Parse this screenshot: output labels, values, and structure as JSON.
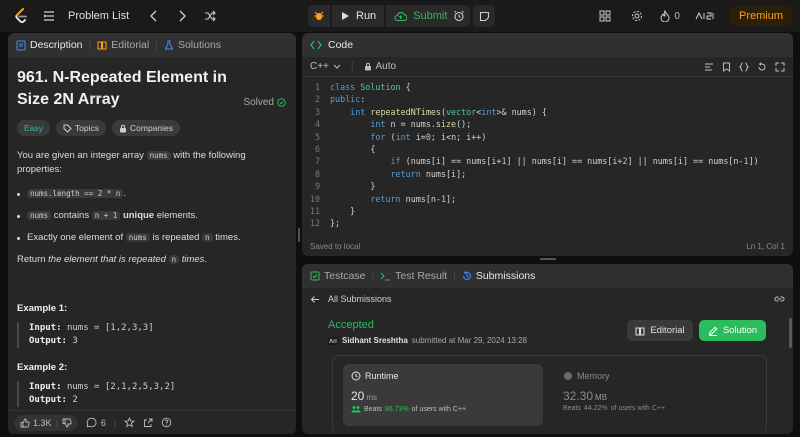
{
  "topbar": {
    "problem_list": "Problem List",
    "run": "Run",
    "submit": "Submit",
    "streak": "0",
    "premium": "Premium"
  },
  "left_panel": {
    "tabs": [
      "Description",
      "Editorial",
      "Solutions"
    ],
    "title": "961. N-Repeated Element in Size 2N Array",
    "solved": "Solved",
    "chips": [
      "Easy",
      "Topics",
      "Companies"
    ],
    "intro_pre": "You are given an integer array ",
    "intro_code": "nums",
    "intro_post": " with the following properties:",
    "prop1_code": "nums.length == 2 * n",
    "prop1_post": ".",
    "prop2_code1": "nums",
    "prop2_mid": " contains ",
    "prop2_code2": "n + 1",
    "prop2_bold": "unique",
    "prop2_post": " elements.",
    "prop3_pre": "Exactly one element of ",
    "prop3_code": "nums",
    "prop3_mid": " is repeated ",
    "prop3_code2": "n",
    "prop3_post": " times.",
    "ret_pre": "Return ",
    "ret_em": "the element that is repeated ",
    "ret_code": "n",
    "ret_em2": " times",
    "ret_post": ".",
    "ex1_title": "Example 1:",
    "ex1_input_label": "Input:",
    "ex1_input": "nums = [1,2,3,3]",
    "ex1_output_label": "Output:",
    "ex1_output": "3",
    "ex2_title": "Example 2:",
    "ex2_input_label": "Input:",
    "ex2_input": "nums = [2,1,2,5,3,2]",
    "ex2_output_label": "Output:",
    "ex2_output": "2",
    "footer": {
      "likes": "1.3K",
      "comments": "6"
    }
  },
  "code_panel": {
    "title": "Code",
    "language": "C++",
    "mode": "Auto",
    "lines": [
      "class Solution {",
      "public:",
      "    int repeatedNTimes(vector<int>& nums) {",
      "        int n = nums.size();",
      "        for (int i=0; i<n; i++)",
      "        {",
      "            if (nums[i] == nums[i+1] || nums[i] == nums[i+2] || nums[i] == nums[n-1])",
      "            return nums[i];",
      "        }",
      "        return nums[n-1];",
      "    }",
      "};"
    ],
    "line_numbers": [
      "1",
      "2",
      "3",
      "4",
      "5",
      "6",
      "7",
      "8",
      "9",
      "10",
      "11",
      "12"
    ],
    "saved": "Saved to local",
    "cursor": "Ln 1, Col 1"
  },
  "bottom_panel": {
    "tabs": [
      "Testcase",
      "Test Result",
      "Submissions"
    ],
    "all_submissions": "All Submissions",
    "status": "Accepted",
    "user": "Sidhant Sreshtha",
    "submitted_at": "submitted at Mar 29, 2024 13:28",
    "editorial_btn": "Editorial",
    "solution_btn": "Solution",
    "runtime": {
      "label": "Runtime",
      "value": "20",
      "unit": "ms",
      "beats_label": "Beats",
      "beats_pct": "86.73%",
      "beats_post": "of users with C++"
    },
    "memory": {
      "label": "Memory",
      "value": "32.30",
      "unit": "MB",
      "beats_label": "Beats",
      "beats_pct": "44.22%",
      "beats_post": "of users with C++"
    }
  },
  "colors": {
    "accent_green": "#2cbb5d",
    "accent_orange": "#ffa116",
    "easy_teal": "#27b8b0",
    "keyword_blue": "#569cd6",
    "type_teal": "#4ec9b0",
    "function_yellow": "#dcdcaa"
  }
}
